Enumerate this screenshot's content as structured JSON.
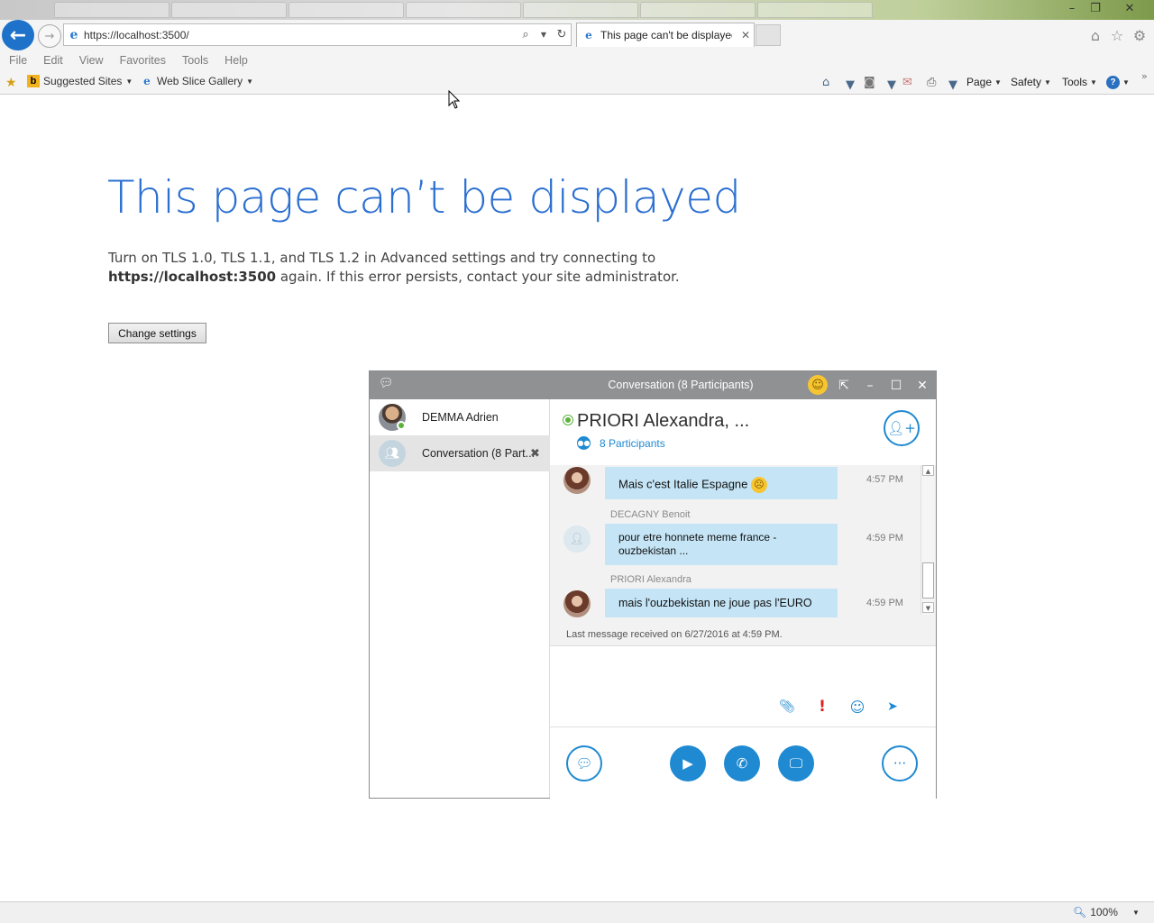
{
  "window": {
    "controls": {
      "minimize": "–",
      "restore": "❐",
      "close": "✕"
    }
  },
  "browser": {
    "url": "https://localhost:3500/",
    "active_tab_title": "This page can't be displayed",
    "menu": [
      "File",
      "Edit",
      "View",
      "Favorites",
      "Tools",
      "Help"
    ],
    "favorites_bar": {
      "suggested_sites": "Suggested Sites",
      "web_slice_gallery": "Web Slice Gallery"
    },
    "command_bar": {
      "page": "Page",
      "safety": "Safety",
      "tools": "Tools"
    },
    "zoom": "100%"
  },
  "error_page": {
    "title": "This page can’t be displayed",
    "line1": "Turn on TLS 1.0, TLS 1.1, and TLS 1.2 in Advanced settings and try connecting to",
    "host_bold": "https://localhost:3500",
    "line2": " again. If this error persists, contact your site administrator.",
    "button": "Change settings"
  },
  "skype": {
    "title": "Conversation (8 Participants)",
    "contacts": [
      {
        "name": "DEMMA Adrien"
      },
      {
        "name": "Conversation (8 Part..."
      }
    ],
    "header_name": "PRIORI Alexandra, ...",
    "participants": "8 Participants",
    "messages": [
      {
        "sender": "",
        "text": "Mais c'est Italie Espagne",
        "time": "4:57 PM"
      },
      {
        "sender": "DECAGNY Benoit",
        "text": "pour etre honnete meme france - ouzbekistan ...",
        "time": "4:59 PM"
      },
      {
        "sender": "PRIORI Alexandra",
        "text": "mais l'ouzbekistan ne joue pas l'EURO",
        "time": "4:59 PM"
      }
    ],
    "last_message": "Last message received on 6/27/2016 at 4:59 PM."
  },
  "icons": {
    "back": "arrow-left-icon",
    "forward": "arrow-right-icon",
    "search": "search-icon",
    "refresh": "refresh-icon",
    "home": "home-icon",
    "favorites": "star-icon",
    "settings": "gear-icon"
  },
  "colors": {
    "error_title": "#2b6fd1",
    "ie_blue": "#1e72c9",
    "skype_blue": "#1f8ad1",
    "bubble": "#c5e5f6",
    "presence_green": "#5cb23a"
  }
}
